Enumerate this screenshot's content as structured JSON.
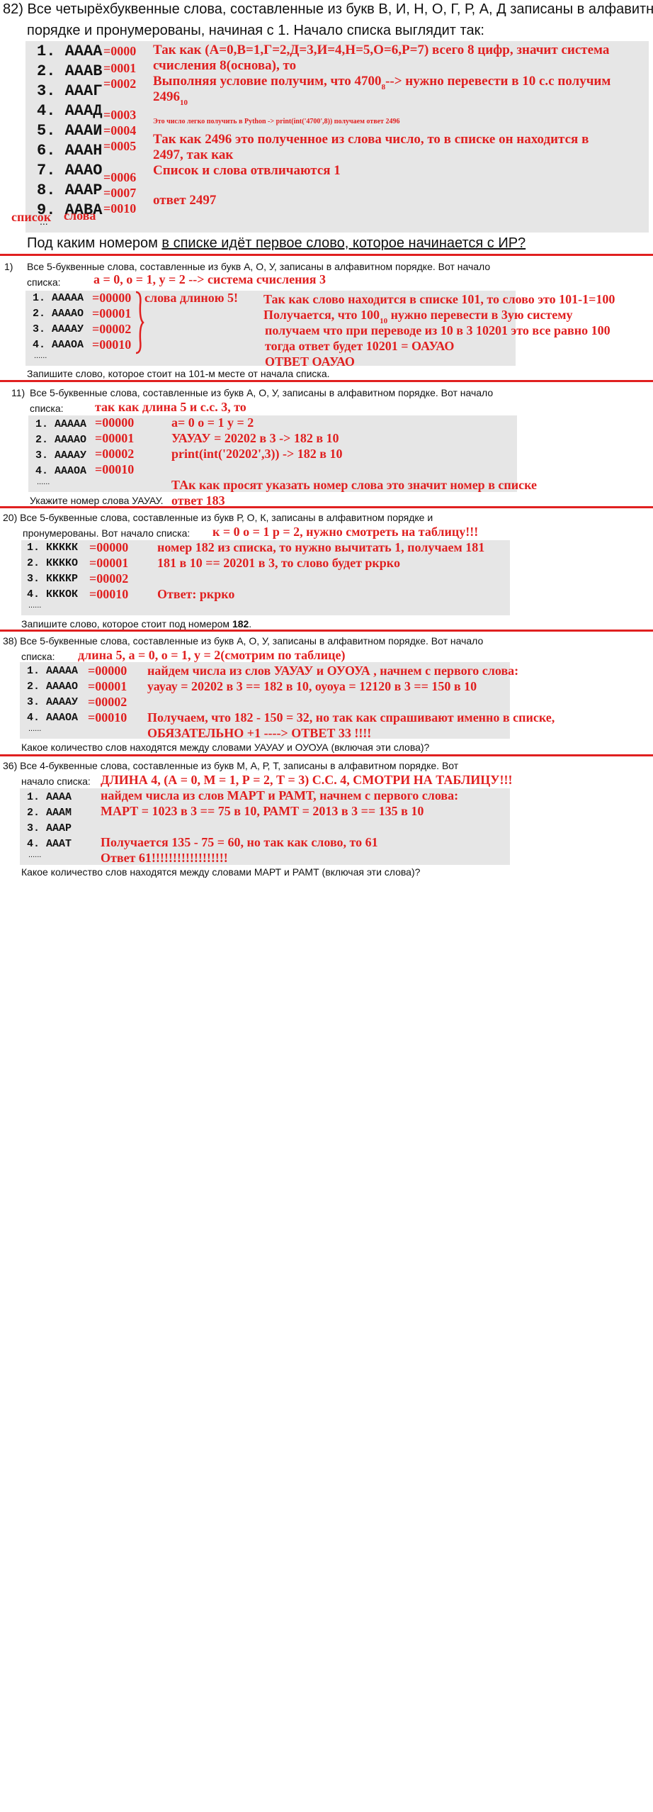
{
  "q82": {
    "line1": "82) Все четырёхбуквенные слова, составленные из букв В, И, Н, О, Г, Р, А, Д записаны в алфавитном",
    "line2": "порядке и пронумерованы, начиная с 1. Начало списка выглядит так:",
    "items": [
      "1. АААА",
      "2. АААВ",
      "3. АААГ",
      "4. АААД",
      "5. АААИ",
      "6. АААН",
      "7. АААО",
      "8. АААР",
      "9. ААВА"
    ],
    "dots": "...",
    "codes": [
      "=0000",
      "=0001",
      "=0002",
      "=0003",
      "=0004",
      "=0005",
      "=0006",
      "=0007",
      "=0010"
    ],
    "note1": "Так как (А=0,В=1,Г=2,Д=3,И=4,Н=5,О=6,Р=7) всего 8 цифр, значит система",
    "note2": "счисления 8(основа), то",
    "note3": "Выполняя условие получим, что 4700",
    "note3_sub": "8",
    "note3_end": "--> нужно перевести в 10 с.с получим",
    "note4": "2496",
    "note4_sub": "10",
    "note_small": "Это число легко получить в Python -> print(int('4700',8)) получаем ответ 2496",
    "note5": "Так как 2496 это полученное из слова число, то в списке он находится в",
    "note6": "2497, так как",
    "note7": "Список и слова отвличаются 1",
    "answer": "ответ 2497",
    "label_list": "список",
    "label_words": "слова",
    "question_a": "Под каким номером ",
    "question_b": "в списке идёт первое слово, которое начинается с ИР?"
  },
  "q1": {
    "num": "1)",
    "line1": "Все 5-буквенные слова, составленные из букв А, О, У, записаны в алфавитном порядке.  Вот начало",
    "line2": "списка:",
    "red_top": "а = 0, о = 1, у = 2  --> система счисления 3",
    "items": [
      "1. ААААА",
      "2. ААААО",
      "3. ААААУ",
      "4. АААОА"
    ],
    "dots": "......",
    "codes": [
      "=00000",
      "=00001",
      "=00002",
      "=00010"
    ],
    "brace_note": "слова длиною 5!",
    "n1": "Так как слово находится в списке 101, то слово это 101-1=100",
    "n2": "Получается, что 100",
    "n2_end": " нужно перевести в 3ую систему",
    "n3": "получаем что при переводе из 10 в 3 10201 это все равно 100",
    "n4": "тогда ответ будет 10201 = ОАУАО",
    "n5": "ОТВЕТ ОАУАО",
    "task": "Запишите слово, которое  стоит на 101-м месте от начала списка."
  },
  "q11": {
    "num": "11)",
    "line1": "Все 5-буквенные слова, составленные из букв А, О, У, записаны в алфавитном порядке.  Вот начало",
    "line2": "списка:",
    "red_top": "так как длина 5 и с.с. 3, то",
    "items": [
      "1. ААААА",
      "2. ААААО",
      "3. ААААУ",
      "4. АААОА"
    ],
    "dots": "......",
    "codes": [
      "=00000",
      "=00001",
      "=00002",
      "=00010"
    ],
    "n1": "а= 0 о = 1 у = 2",
    "n2": "УАУАУ = 20202 в 3 -> 182 в 10",
    "n3": "print(int('20202',3)) -> 182 в 10",
    "n4": "ТАк как просят указать номер слова это значит номер в списке",
    "n5": "ответ 183",
    "task": "Укажите номер слова УАУАУ."
  },
  "q20": {
    "line1": "20)  Все 5-буквенные слова, составленные из букв Р, О, К, записаны в алфавитном порядке  и",
    "line2": "пронумерованы. Вот начало списка:",
    "red_top": "к = 0 о = 1 р = 2, нужно смотреть на таблицу!!!",
    "items": [
      "1. ККККК",
      "2. ККККО",
      "3. ККККР",
      "4. КККОК"
    ],
    "dots": "......",
    "codes": [
      "=00000",
      "=00001",
      "=00002",
      "=00010"
    ],
    "n1": "номер 182 из списка, то нужно вычитать 1, получаем 181",
    "n2": "181 в 10 == 20201 в 3, то слово будет ркрко",
    "n3": "Ответ: ркрко",
    "task_a": "Запишите слово, которое  стоит под номером ",
    "task_b": "182",
    "task_c": "."
  },
  "q38": {
    "line1": "38)  Все 5-буквенные слова, составленные из букв А, О, У, записаны в алфавитном порядке.  Вот начало",
    "line2": "списка:",
    "red_top": "длина 5, а = 0, о = 1, у = 2(смотрим по таблице)",
    "items": [
      "1. ААААА",
      "2. ААААО",
      "3. ААААУ",
      "4. АААОА"
    ],
    "dots": "......",
    "codes": [
      "=00000",
      "=00001",
      "=00002",
      "=00010"
    ],
    "n1": "найдем числа из слов УАУАУ и ОУОУА , начнем с первого слова:",
    "n2": "уауау = 20202 в 3 == 182 в 10, оуоуа = 12120 в 3 == 150 в 10",
    "n3": "Получаем, что 182 - 150 = 32, но так как спрашивают именно в списке,",
    "n4": "ОБЯЗАТЕЛЬНО +1 ----> ОТВЕТ 33 !!!!",
    "task": "Какое количество слов находятся между словами УАУАУ и ОУОУА (включая эти слова)?"
  },
  "q36": {
    "line1": "36)  Все 4-буквенные слова, составленные из букв М, А, Р, Т, записаны в алфавитном порядке. Вот",
    "line2": "начало списка:",
    "red_top": "ДЛИНА 4, (А = 0, М = 1, Р = 2, Т = 3) С.С. 4, СМОТРИ НА ТАБЛИЦУ!!!",
    "items": [
      "1. АААА",
      "2. АААМ",
      "3. АААР",
      "4. АААТ"
    ],
    "dots": "......",
    "n1": "найдем числа из слов МАРТ и РАМТ, начнем с первого слова:",
    "n2": "МАРТ  = 1023 в  3 == 75 в 10, РАМТ = 2013 в 3 == 135 в 10",
    "n3": "Получается 135 - 75 = 60, но так как слово, то 61",
    "n4": "Ответ 61!!!!!!!!!!!!!!!!!!",
    "task": "Какое количество слов находятся между словами МАРТ и РАМТ (включая эти слова)?"
  },
  "colors": {
    "annotation": "#e02020",
    "box": "#e6e6e6"
  }
}
